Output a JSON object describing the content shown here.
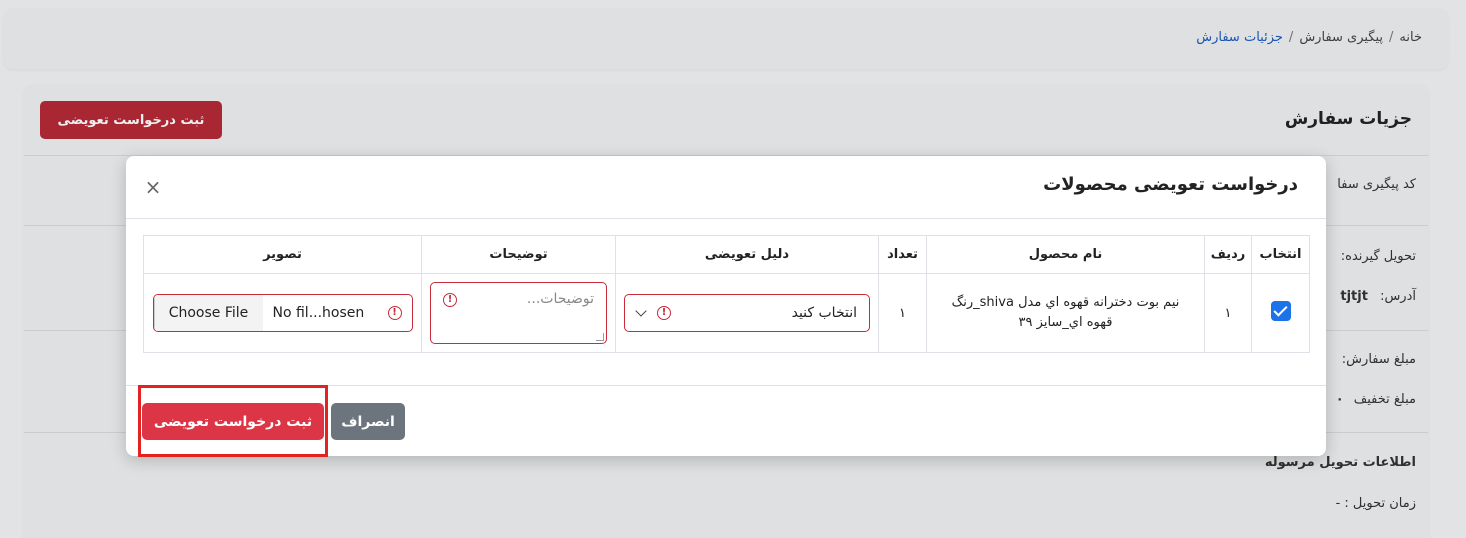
{
  "breadcrumb": {
    "home": "خانه",
    "tracking": "پیگیری سفارش",
    "current": "جزئیات سفارش",
    "separator": "/"
  },
  "page": {
    "title": "جزیات سفارش",
    "submit_label": "ثبت درخواست تعویضی",
    "tracking_code_label": "کد پیگیری سفا",
    "receiver_label": "تحویل گیرنده:",
    "address_label": "آدرس:",
    "address_value": "tjtjt",
    "order_amount_label": "مبلغ سفارش:",
    "discount_label": "مبلغ تخفیف",
    "discount_value": "۰",
    "delivery_info_title": "اطلاعات تحویل مرسوله",
    "delivery_time_label": "زمان تحویل : -"
  },
  "modal": {
    "title": "درخواست تعویضی محصولات",
    "close_glyph": "×",
    "columns": [
      "انتخاب",
      "ردیف",
      "نام محصول",
      "تعداد",
      "دلیل تعویضی",
      "توضیحات",
      "تصویر"
    ],
    "row": {
      "row_number": "۱",
      "product_name_line1": "نیم بوت دخترانه قهوه اي مدل shiva_رنگ",
      "product_name_line2": "قهوه اي_سایز ۳۹",
      "quantity": "۱",
      "reason_placeholder": "انتخاب کنید",
      "description_placeholder": "توضیحات...",
      "file_button": "Choose File",
      "file_status": "No fil...hosen"
    },
    "cancel_label": "انصراف",
    "submit_label": "ثبت درخواست تعویضی"
  },
  "colors": {
    "primary": "#1a73e8",
    "danger": "#dc3545",
    "secondary": "#6c757d",
    "highlight": "#e32222"
  }
}
